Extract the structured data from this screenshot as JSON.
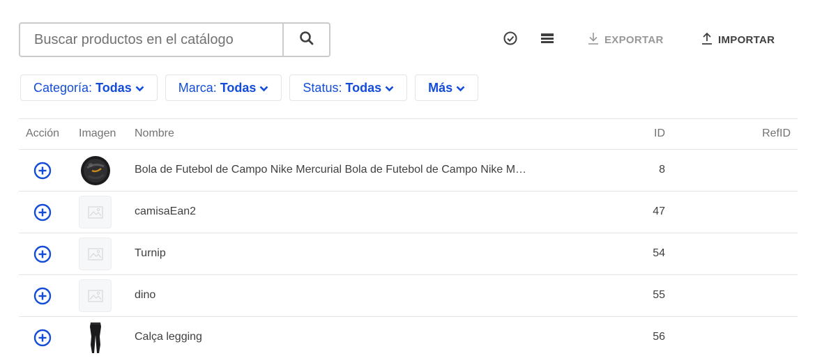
{
  "search": {
    "placeholder": "Buscar productos en el catálogo",
    "value": ""
  },
  "toolbar": {
    "icons": [
      "check-circle-icon",
      "rows-density-icon"
    ],
    "export_label": "EXPORTAR",
    "import_label": "IMPORTAR"
  },
  "filters": [
    {
      "label": "Categoría:",
      "value": "Todas"
    },
    {
      "label": "Marca:",
      "value": "Todas"
    },
    {
      "label": "Status:",
      "value": "Todas"
    },
    {
      "label": "",
      "value": "Más"
    }
  ],
  "table": {
    "columns": [
      "Acción",
      "Imagen",
      "Nombre",
      "ID",
      "RefID"
    ],
    "rows": [
      {
        "image": "soccer-ball",
        "name": "Bola de Futebol de Campo Nike Mercurial Bola de Futebol de Campo Nike Mercurial",
        "id": "8",
        "refid": ""
      },
      {
        "image": "placeholder",
        "name": "camisaEan2",
        "id": "47",
        "refid": ""
      },
      {
        "image": "placeholder",
        "name": "Turnip",
        "id": "54",
        "refid": ""
      },
      {
        "image": "placeholder",
        "name": "dino",
        "id": "55",
        "refid": ""
      },
      {
        "image": "leggings",
        "name": "Calça legging",
        "id": "56",
        "refid": ""
      }
    ]
  },
  "colors": {
    "accent": "#134cd8",
    "text": "#3f3f40",
    "muted": "#727273",
    "disabled": "#979899",
    "border": "#e3e4e6"
  }
}
